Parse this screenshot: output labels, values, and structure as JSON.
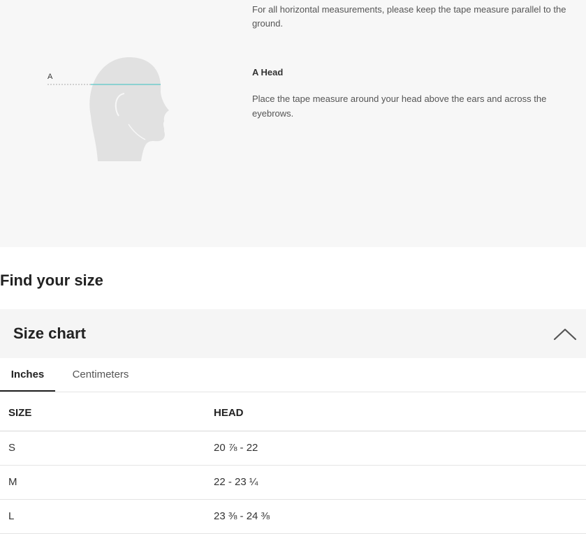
{
  "guide": {
    "intro": "For all horizontal measurements, please keep the tape measure parallel to the ground.",
    "measure_letter": "A",
    "measure_title": "A Head",
    "measure_desc": "Place the tape measure around your head above the ears and across the eyebrows.",
    "colors": {
      "figure": "#e0e0e0",
      "tape": "#5ac8c8"
    }
  },
  "find_title": "Find your size",
  "size_chart": {
    "title": "Size chart",
    "collapse_icon": "chevron-up-icon",
    "tabs": [
      {
        "label": "Inches",
        "active": true
      },
      {
        "label": "Centimeters",
        "active": false
      }
    ],
    "columns": [
      "SIZE",
      "HEAD"
    ],
    "rows": [
      [
        "S",
        "20 ⅞ - 22"
      ],
      [
        "M",
        "22 - 23 ¼"
      ],
      [
        "L",
        "23 ⅜ - 24 ⅜"
      ]
    ]
  }
}
